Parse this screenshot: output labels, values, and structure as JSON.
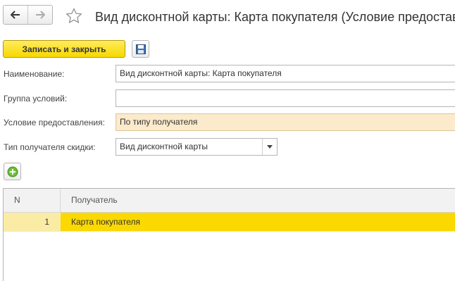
{
  "header": {
    "title": "Вид дисконтной карты: Карта покупателя (Условие предоставления)",
    "back_icon": "arrow-left-icon",
    "forward_icon": "arrow-right-icon",
    "favorite_icon": "star-icon"
  },
  "toolbar": {
    "save_close_label": "Записать и закрыть",
    "save_icon": "floppy-disk-icon",
    "accent_color": "#f7d800"
  },
  "form": {
    "name_label": "Наименование:",
    "name_value": "Вид дисконтной карты: Карта покупателя",
    "group_label": "Группа условий:",
    "group_value": "",
    "condition_label": "Условие предоставления:",
    "condition_value": "По типу получателя",
    "recipient_type_label": "Тип получателя скидки:",
    "recipient_type_value": "Вид дисконтной карты"
  },
  "table": {
    "add_icon": "plus-circle-icon",
    "columns": [
      "N",
      "Получатель"
    ],
    "rows": [
      {
        "n": "1",
        "recipient": "Карта покупателя",
        "selected": true
      }
    ]
  }
}
